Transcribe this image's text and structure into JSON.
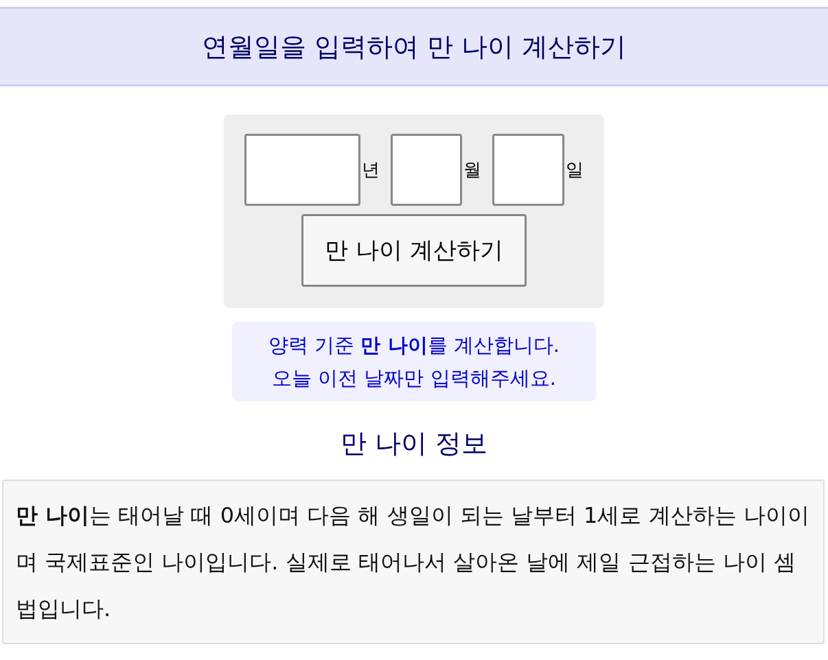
{
  "header": {
    "title": "연월일을 입력하여 만 나이 계산하기"
  },
  "form": {
    "fields": [
      {
        "unit": "년",
        "kind": "year"
      },
      {
        "unit": "월",
        "kind": "month"
      },
      {
        "unit": "일",
        "kind": "day"
      }
    ],
    "button": "만 나이 계산하기"
  },
  "notice": [
    "양력 기준 **만 나이**를 계산합니다.",
    "오늘 이전 날짜만 입력해주세요."
  ],
  "info": {
    "heading": "만 나이 정보",
    "text": "**만 나이**는 태어날 때 0세이며 다음 해 생일이 되는 날부터 1세로 계산하는 나이이며 국제표준인 나이입니다. 실제로 태어나서 살아온 날에 제일 근접하는 나이 셈법입니다."
  }
}
